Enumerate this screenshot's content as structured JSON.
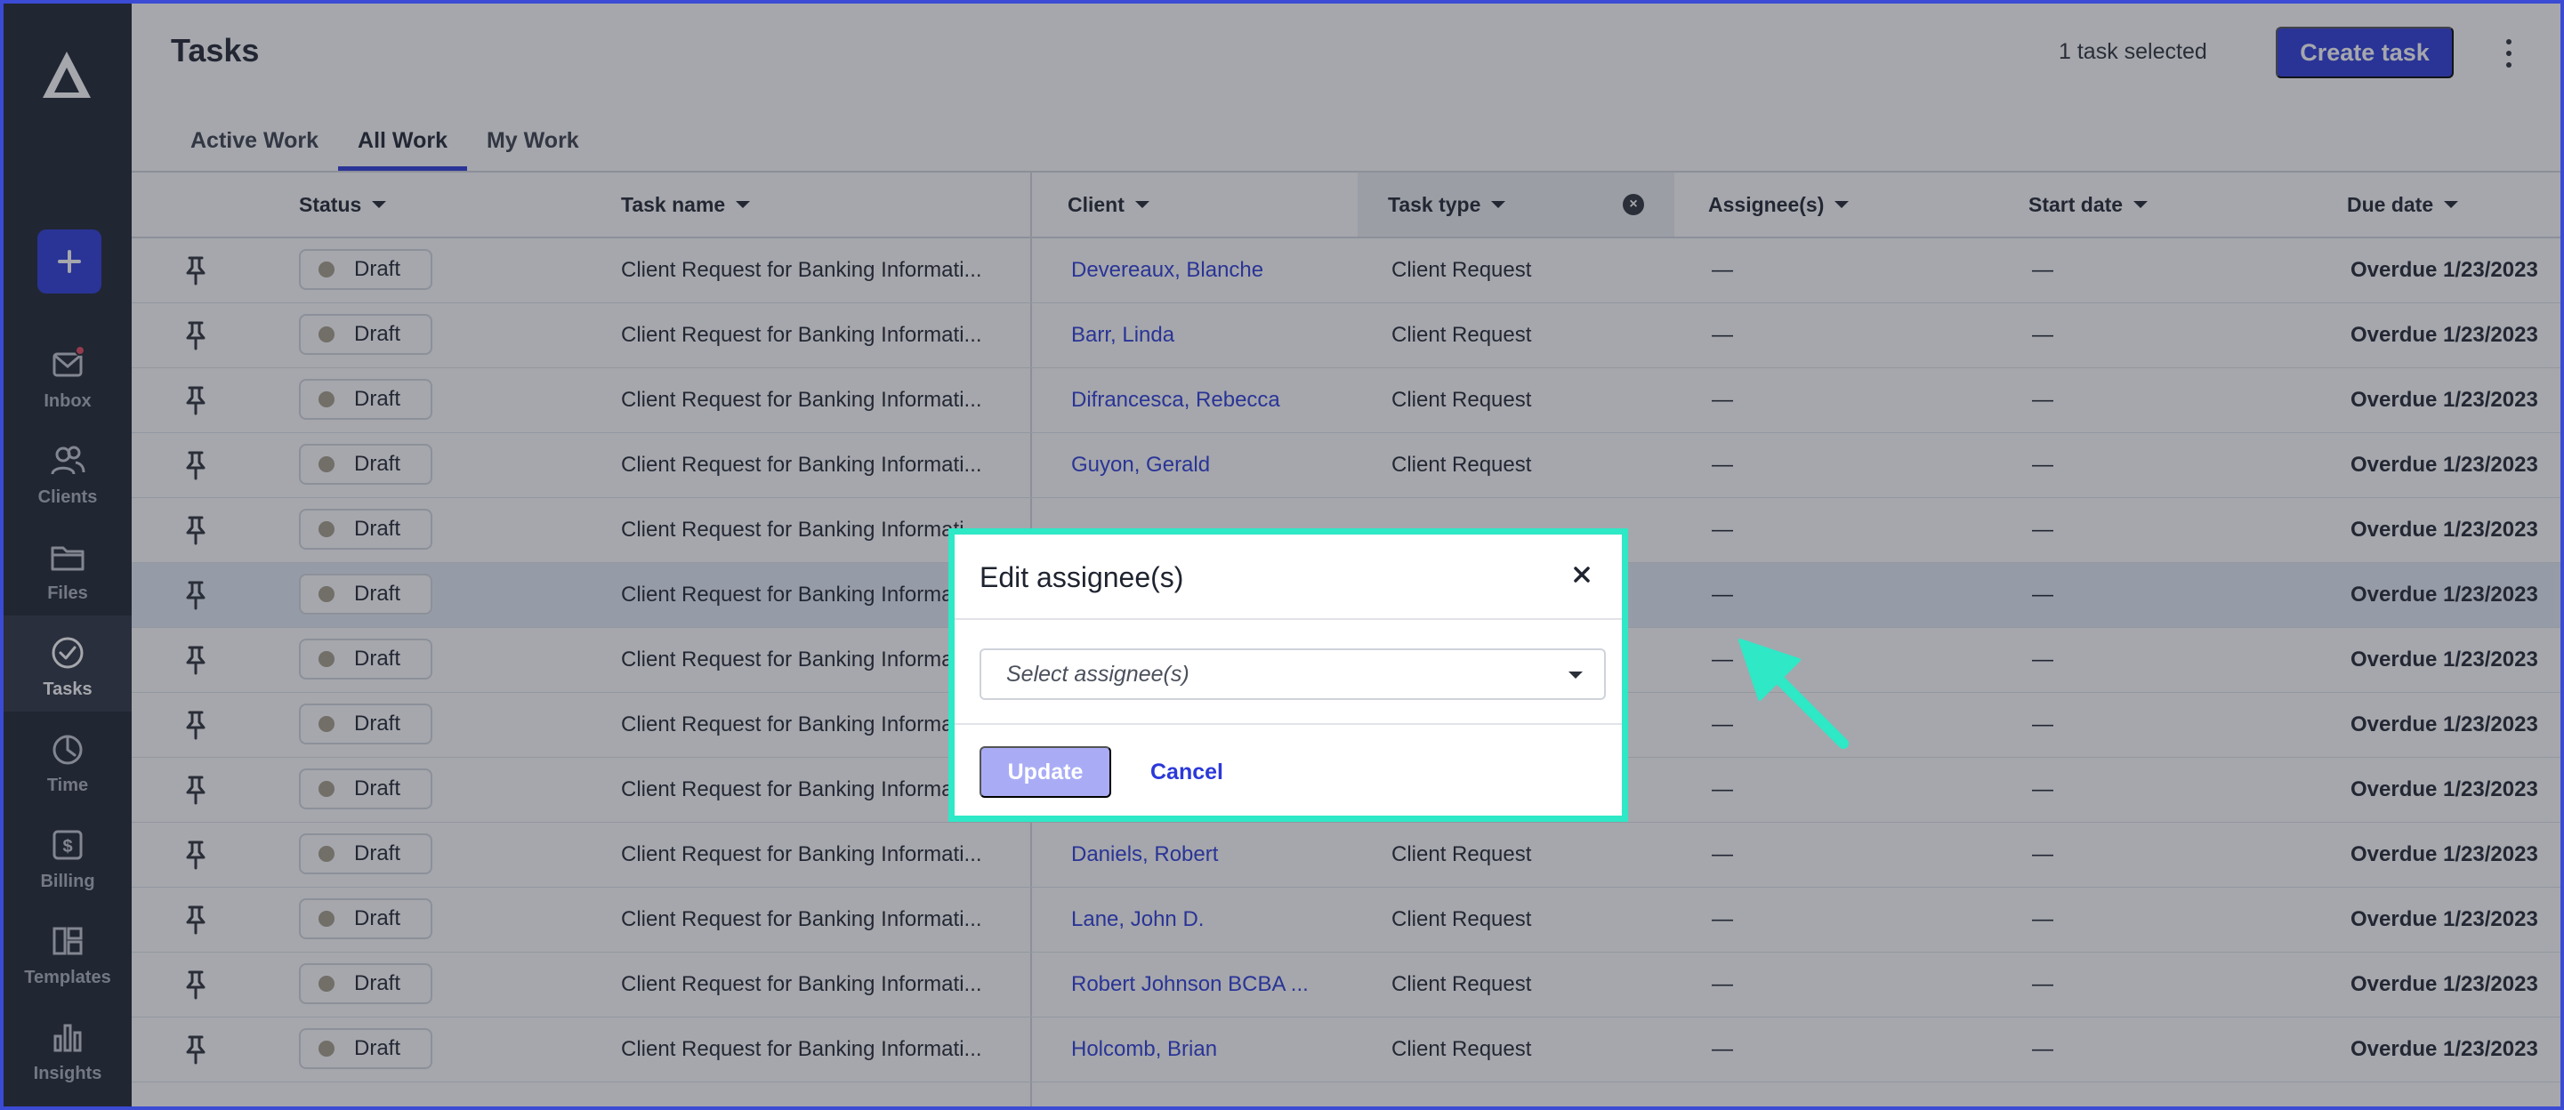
{
  "sidebar": {
    "items": [
      {
        "label": "Inbox",
        "icon": "mail-icon"
      },
      {
        "label": "Clients",
        "icon": "clients-icon"
      },
      {
        "label": "Files",
        "icon": "folder-icon"
      },
      {
        "label": "Tasks",
        "icon": "check-circle-icon"
      },
      {
        "label": "Time",
        "icon": "timer-icon"
      },
      {
        "label": "Billing",
        "icon": "billing-icon"
      },
      {
        "label": "Templates",
        "icon": "templates-icon"
      },
      {
        "label": "Insights",
        "icon": "bar-chart-icon"
      }
    ],
    "active": "Tasks",
    "add_button": "+"
  },
  "header": {
    "title": "Tasks",
    "selected_text": "1 task selected",
    "create_button": "Create task"
  },
  "tabs": [
    {
      "label": "Active Work"
    },
    {
      "label": "All Work"
    },
    {
      "label": "My Work"
    }
  ],
  "active_tab": "All Work",
  "table": {
    "columns": [
      "Status",
      "Task name",
      "Client",
      "Task type",
      "Assignee(s)",
      "Start date",
      "Due date"
    ],
    "rows": [
      {
        "status": "Draft",
        "task": "Client Request for Banking Informati...",
        "client": "Devereaux, Blanche",
        "type": "Client Request",
        "assignee": "—",
        "start": "—",
        "due": "Overdue 1/23/2023"
      },
      {
        "status": "Draft",
        "task": "Client Request for Banking Informati...",
        "client": "Barr, Linda",
        "type": "Client Request",
        "assignee": "—",
        "start": "—",
        "due": "Overdue 1/23/2023"
      },
      {
        "status": "Draft",
        "task": "Client Request for Banking Informati...",
        "client": "Difrancesca, Rebecca",
        "type": "Client Request",
        "assignee": "—",
        "start": "—",
        "due": "Overdue 1/23/2023"
      },
      {
        "status": "Draft",
        "task": "Client Request for Banking Informati...",
        "client": "Guyon, Gerald",
        "type": "Client Request",
        "assignee": "—",
        "start": "—",
        "due": "Overdue 1/23/2023"
      },
      {
        "status": "Draft",
        "task": "Client Request for Banking Informati...",
        "client": "",
        "type": "",
        "assignee": "—",
        "start": "—",
        "due": "Overdue 1/23/2023"
      },
      {
        "status": "Draft",
        "task": "Client Request for Banking Informati...",
        "client": "",
        "type": "",
        "assignee": "—",
        "start": "—",
        "due": "Overdue 1/23/2023"
      },
      {
        "status": "Draft",
        "task": "Client Request for Banking Informati...",
        "client": "",
        "type": "",
        "assignee": "—",
        "start": "—",
        "due": "Overdue 1/23/2023"
      },
      {
        "status": "Draft",
        "task": "Client Request for Banking Informati...",
        "client": "",
        "type": "",
        "assignee": "—",
        "start": "—",
        "due": "Overdue 1/23/2023"
      },
      {
        "status": "Draft",
        "task": "Client Request for Banking Informati...",
        "client": "",
        "type": "",
        "assignee": "—",
        "start": "—",
        "due": "Overdue 1/23/2023"
      },
      {
        "status": "Draft",
        "task": "Client Request for Banking Informati...",
        "client": "Daniels, Robert",
        "type": "Client Request",
        "assignee": "—",
        "start": "—",
        "due": "Overdue 1/23/2023"
      },
      {
        "status": "Draft",
        "task": "Client Request for Banking Informati...",
        "client": "Lane, John D.",
        "type": "Client Request",
        "assignee": "—",
        "start": "—",
        "due": "Overdue 1/23/2023"
      },
      {
        "status": "Draft",
        "task": "Client Request for Banking Informati...",
        "client": "Robert Johnson BCBA ...",
        "type": "Client Request",
        "assignee": "—",
        "start": "—",
        "due": "Overdue 1/23/2023"
      },
      {
        "status": "Draft",
        "task": "Client Request for Banking Informati...",
        "client": "Holcomb, Brian",
        "type": "Client Request",
        "assignee": "—",
        "start": "—",
        "due": "Overdue 1/23/2023"
      }
    ]
  },
  "modal": {
    "title": "Edit assignee(s)",
    "select_placeholder": "Select assignee(s)",
    "update_button": "Update",
    "cancel_button": "Cancel"
  },
  "colors": {
    "accent": "#2b39d9",
    "sidebar_bg": "#1d2230",
    "modal_highlight": "#2ee8c6",
    "arrow": "#2ee8c6"
  }
}
